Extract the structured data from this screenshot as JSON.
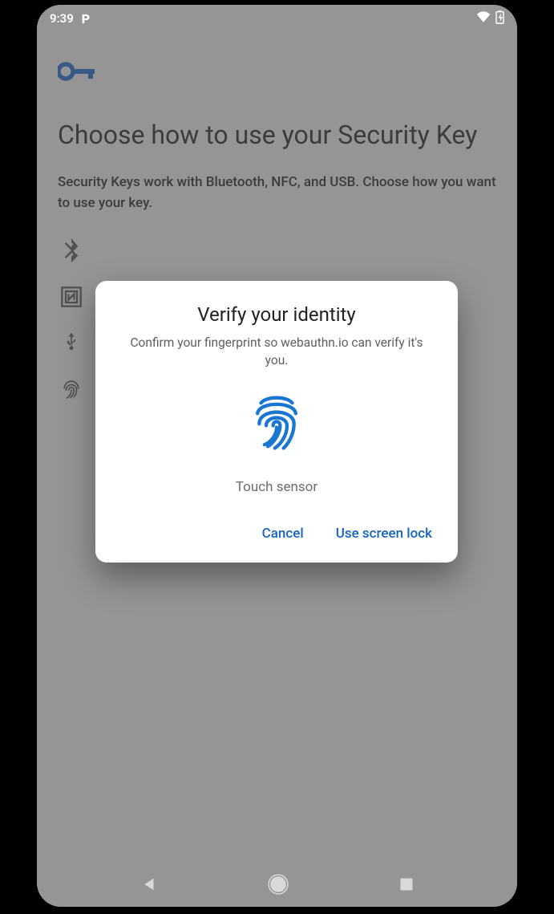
{
  "statusbar": {
    "time": "9:39",
    "app_indicator": "P"
  },
  "page": {
    "title": "Choose how to use your Security Key",
    "subtitle": "Security Keys work with Bluetooth, NFC, and USB. Choose how you want to use your key.",
    "options": [
      {
        "icon": "bluetooth",
        "label": ""
      },
      {
        "icon": "nfc",
        "label": ""
      },
      {
        "icon": "usb",
        "label": ""
      },
      {
        "icon": "fingerprint",
        "label": ""
      }
    ]
  },
  "dialog": {
    "title": "Verify your identity",
    "message": "Confirm your fingerprint so webauthn.io can verify it's you.",
    "sensor_hint": "Touch sensor",
    "cancel_label": "Cancel",
    "alt_label": "Use screen lock"
  },
  "colors": {
    "accent": "#1565c0",
    "key_icon": "#1a68d2",
    "fingerprint": "#1976d2"
  }
}
